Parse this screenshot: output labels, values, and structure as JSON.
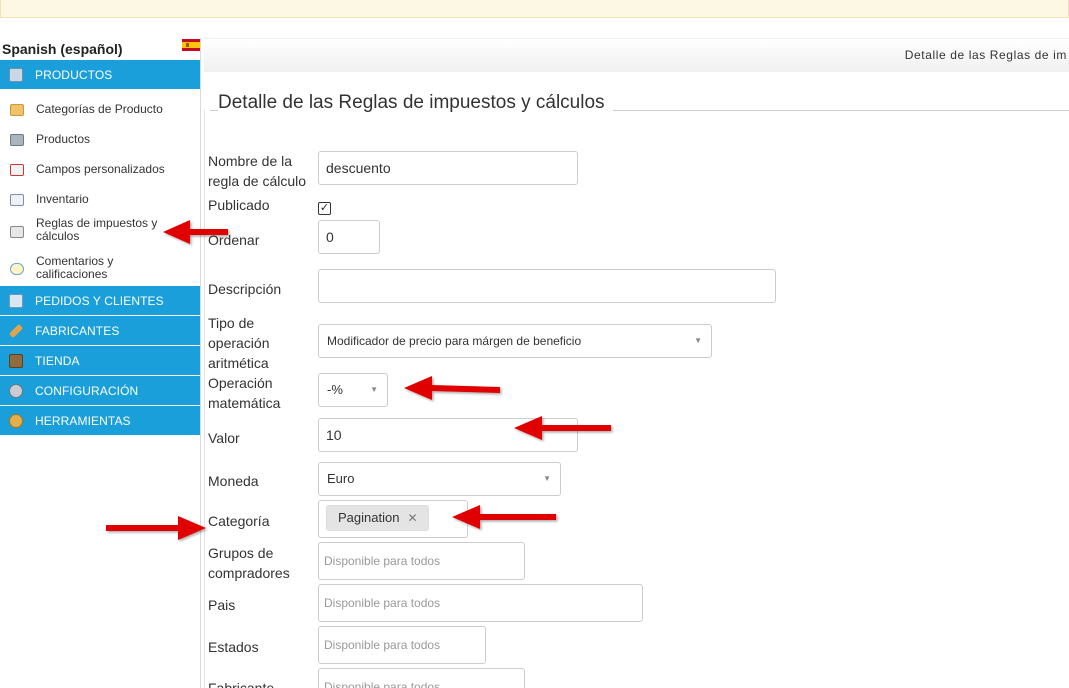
{
  "sidebar": {
    "language": "Spanish (español)",
    "menus": [
      {
        "label": "PRODUCTOS",
        "icon": "products-icon"
      },
      {
        "label": "PEDIDOS Y CLIENTES",
        "icon": "orders-icon"
      },
      {
        "label": "FABRICANTES",
        "icon": "wrench-icon"
      },
      {
        "label": "TIENDA",
        "icon": "store-icon"
      },
      {
        "label": "CONFIGURACIÓN",
        "icon": "config-icon"
      },
      {
        "label": "HERRAMIENTAS",
        "icon": "tools-icon"
      }
    ],
    "items": [
      {
        "label": "Categorías de Producto",
        "icon": "category-icon"
      },
      {
        "label": "Productos",
        "icon": "camera-icon"
      },
      {
        "label": "Campos personalizados",
        "icon": "custom-fields-icon"
      },
      {
        "label": "Inventario",
        "icon": "inventory-icon"
      },
      {
        "label": "Reglas de impuestos y cálculos",
        "icon": "calculator-icon"
      },
      {
        "label": "Comentarios y calificaciones",
        "icon": "comments-icon"
      }
    ],
    "accent": "#1a9fdb"
  },
  "header": {
    "breadcrumb": "Detalle de las Reglas de im"
  },
  "form": {
    "legend": "Detalle de las Reglas de impuestos y cálculos",
    "name_label": "Nombre de la regla de cálculo",
    "name_value": "descuento",
    "published_label": "Publicado",
    "published_checked": true,
    "order_label": "Ordenar",
    "order_value": "0",
    "description_label": "Descripción",
    "description_value": "",
    "optype_label": "Tipo de operación aritmética",
    "optype_value": "Modificador de precio para márgen de beneficio",
    "math_label": "Operación matemática",
    "math_value": "-%",
    "value_label": "Valor",
    "value_value": "10",
    "currency_label": "Moneda",
    "currency_value": "Euro",
    "category_label": "Categoría",
    "category_chip": "Pagination",
    "groups_label": "Grupos de compradores",
    "groups_placeholder": "Disponible para todos",
    "country_label": "Pais",
    "country_placeholder": "Disponible para todos",
    "states_label": "Estados",
    "states_placeholder": "Disponible para todos",
    "manufacturer_label": "Fabricante",
    "manufacturer_placeholder": "Disponible para todos"
  },
  "annotation_color": "#e00000"
}
